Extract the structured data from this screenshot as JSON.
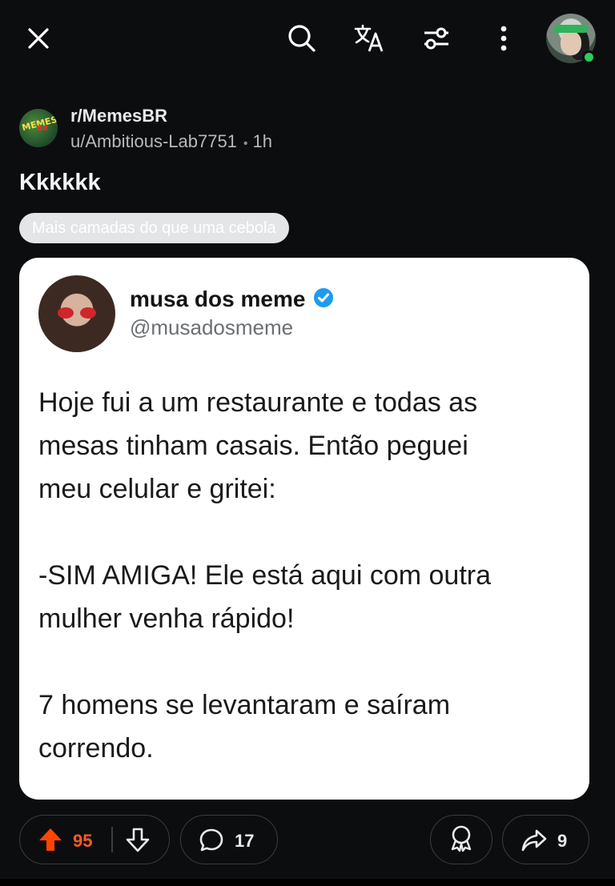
{
  "topbar": {
    "icons": [
      "close-icon",
      "search-icon",
      "translate-icon",
      "filter-icon",
      "more-vert-icon",
      "profile-avatar"
    ],
    "online_color": "#2dcc5b"
  },
  "post": {
    "subreddit": "r/MemesBR",
    "subreddit_icon_text": "MEMES BR",
    "author": "u/Ambitious-Lab7751",
    "separator": "•",
    "time": "1h",
    "title": "Kkkkkk",
    "flair": "Mais camadas do que uma cebola"
  },
  "tweet": {
    "name": "musa dos meme",
    "handle": "@musadosmeme",
    "verified_color": "#1d9bf0",
    "lines": [
      "Hoje fui a um restaurante e todas as",
      "mesas tinham casais. Então peguei",
      "meu celular e gritei:",
      "",
      "-SIM AMIGA! Ele está aqui com outra",
      "mulher venha rápido!",
      "",
      "7 homens se levantaram e saíram",
      "correndo."
    ]
  },
  "actions": {
    "upvotes": "95",
    "comments": "17",
    "shares": "9",
    "upvote_color": "#ff4500"
  }
}
